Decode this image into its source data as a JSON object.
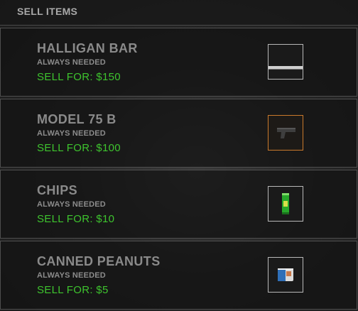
{
  "header": {
    "title": "SELL ITEMS"
  },
  "colors": {
    "price_green": "#3ec42e",
    "label_gray": "#8a8a8a",
    "accent_orange": "#c9792c"
  },
  "items": [
    {
      "name": "HALLIGAN BAR",
      "subtitle": "ALWAYS NEEDED",
      "price": "SELL FOR: $150",
      "icon": "bar-icon"
    },
    {
      "name": "MODEL 75 B",
      "subtitle": "ALWAYS NEEDED",
      "price": "SELL FOR: $100",
      "icon": "pistol-icon"
    },
    {
      "name": "CHIPS",
      "subtitle": "ALWAYS NEEDED",
      "price": "SELL FOR: $10",
      "icon": "chips-can-icon"
    },
    {
      "name": "CANNED PEANUTS",
      "subtitle": "ALWAYS NEEDED",
      "price": "SELL FOR: $5",
      "icon": "peanut-can-icon"
    }
  ]
}
